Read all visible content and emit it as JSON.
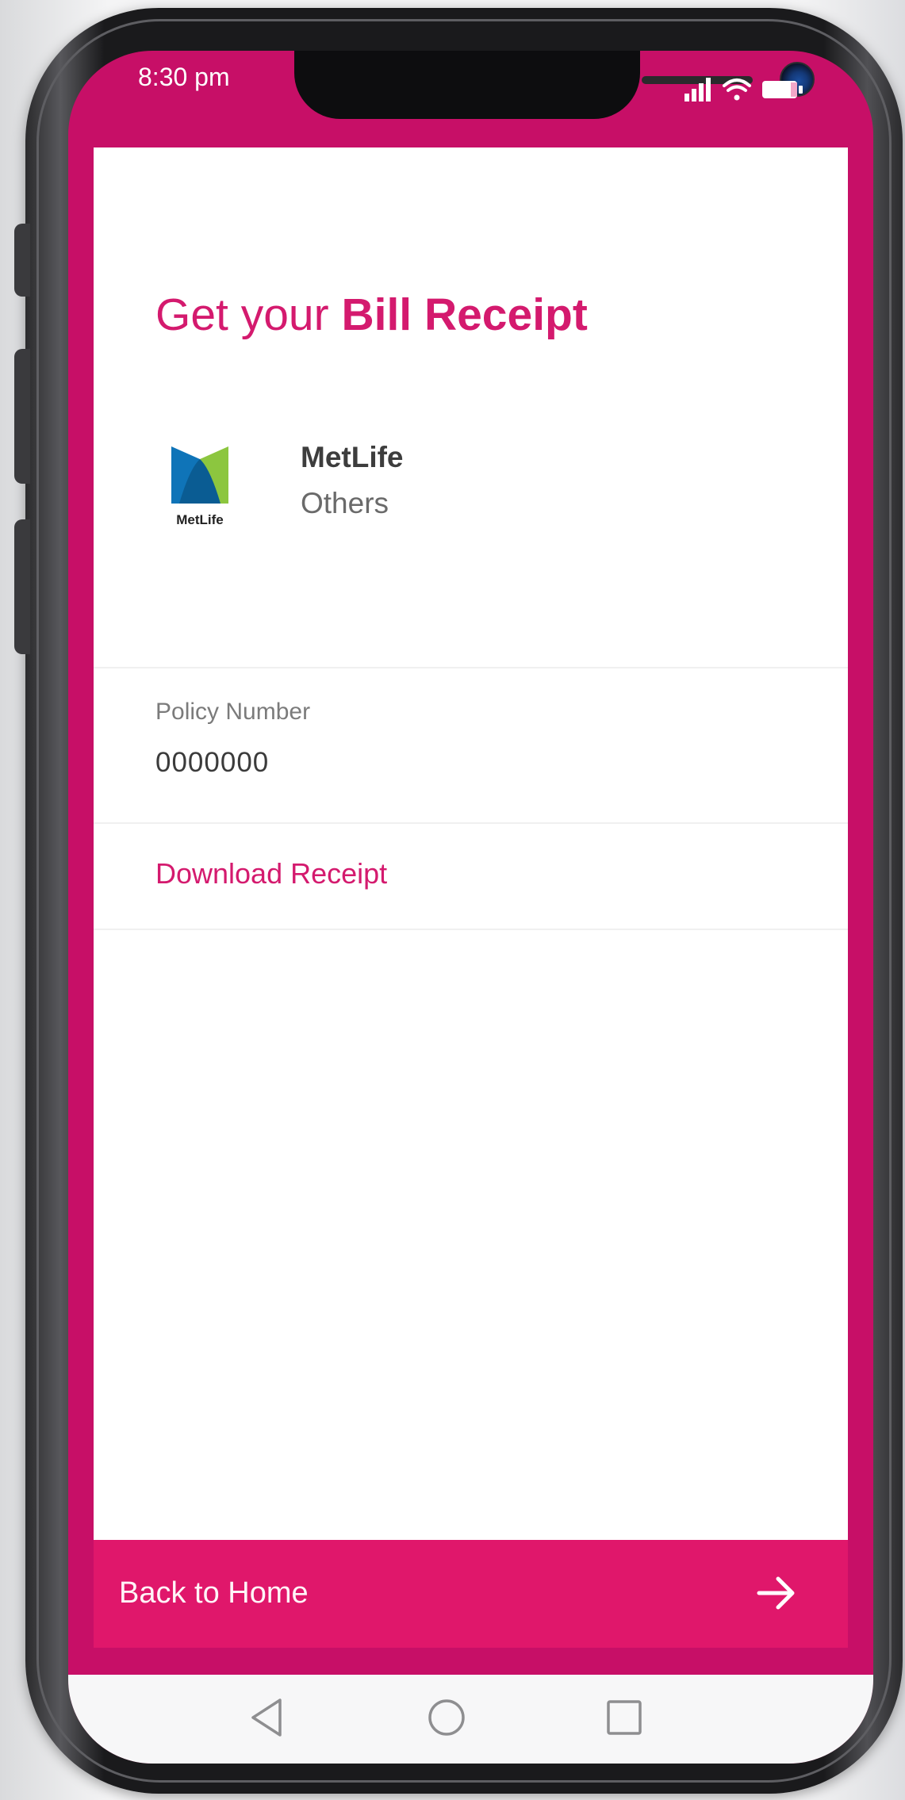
{
  "status_bar": {
    "time": "8:30 pm",
    "icons": [
      "signal-icon",
      "wifi-icon",
      "battery-icon"
    ]
  },
  "header": {
    "title_regular": "Get your ",
    "title_bold": "Bill Receipt"
  },
  "provider": {
    "logo_text": "MetLife",
    "name": "MetLife",
    "category": "Others"
  },
  "policy": {
    "label": "Policy Number",
    "value": "0000000"
  },
  "actions": {
    "download_label": "Download Receipt",
    "back_label": "Back to Home"
  },
  "nav": {
    "buttons": [
      "back-triangle-icon",
      "home-circle-icon",
      "recent-square-icon"
    ]
  },
  "colors": {
    "brand_magenta": "#c70f67",
    "accent_pink": "#d41a6e",
    "button_pink": "#e0176b",
    "metlife_blue": "#0f74b8",
    "metlife_green": "#8cc63f"
  }
}
